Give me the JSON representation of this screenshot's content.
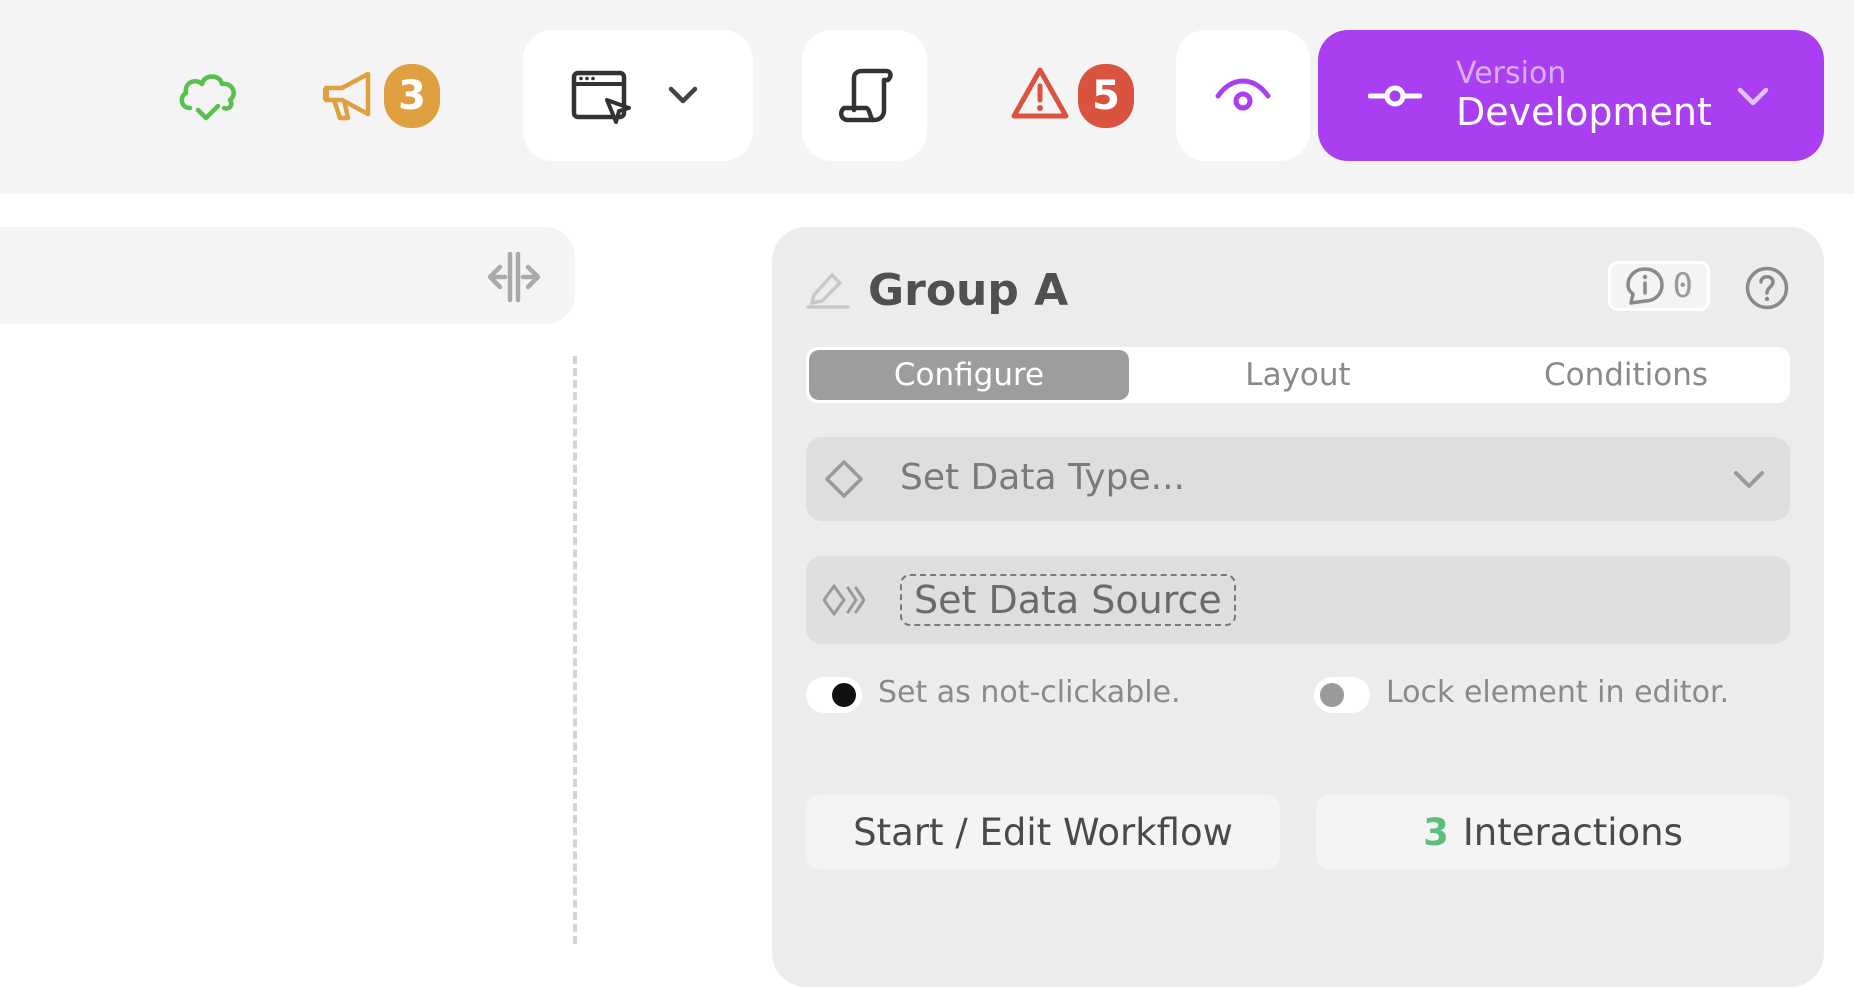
{
  "topbar": {
    "announcements_badge": "3",
    "warnings_badge": "5",
    "version": {
      "label": "Version",
      "value": "Development"
    }
  },
  "panel": {
    "title": "Group A",
    "comments_count": "0",
    "tabs": [
      {
        "label": "Configure",
        "active": true
      },
      {
        "label": "Layout",
        "active": false
      },
      {
        "label": "Conditions",
        "active": false
      }
    ],
    "data_type_placeholder": "Set Data Type...",
    "data_source_label": "Set Data Source",
    "toggles": [
      {
        "label": "Set as not-clickable.",
        "on": true
      },
      {
        "label": "Lock element in editor.",
        "on": false
      }
    ],
    "workflow_button": "Start / Edit Workflow",
    "interactions": {
      "count": "3",
      "label": "Interactions"
    }
  },
  "colors": {
    "accent": "#a93ff0",
    "cloud_ok": "#5bbf4f",
    "announcement": "#e0a040",
    "warning": "#d9533f",
    "interactions_count": "#5bbf7a"
  },
  "icons": [
    "cloud-check-icon",
    "megaphone-icon",
    "browser-cursor-icon",
    "chevron-down-icon",
    "scroll-icon",
    "warning-triangle-icon",
    "eye-icon",
    "commit-icon",
    "split-resize-icon",
    "pencil-icon",
    "comment-info-icon",
    "help-icon",
    "diamond-icon",
    "source-chevrons-icon"
  ]
}
